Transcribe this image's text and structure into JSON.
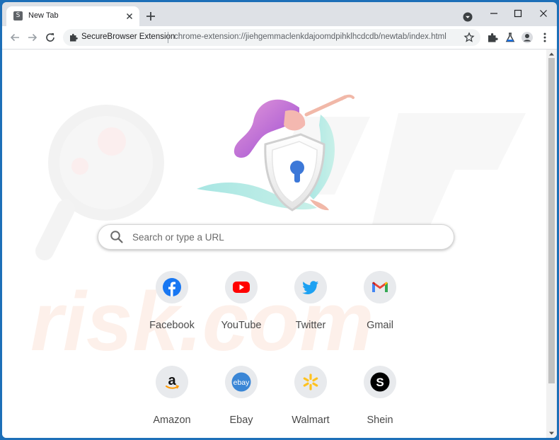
{
  "tab": {
    "title": "New Tab",
    "favicon_letter": "S"
  },
  "omnibox": {
    "origin": "SecureBrowser Extension",
    "url": "chrome-extension://jiehgemmaclenkdajoomdpihklhcdcdb/newtab/index.html"
  },
  "search": {
    "placeholder": "Search or type a URL"
  },
  "watermark_text": "risk.com",
  "shortcuts": [
    {
      "label": "Facebook",
      "icon": "facebook-icon",
      "color": "#1877f2"
    },
    {
      "label": "YouTube",
      "icon": "youtube-icon",
      "color": "#ff0000"
    },
    {
      "label": "Twitter",
      "icon": "twitter-icon",
      "color": "#1da1f2"
    },
    {
      "label": "Gmail",
      "icon": "gmail-icon",
      "color": "#ea4335"
    },
    {
      "label": "Amazon",
      "icon": "amazon-icon",
      "color": "#ff9900"
    },
    {
      "label": "Ebay",
      "icon": "ebay-icon",
      "color": "#3a86d6"
    },
    {
      "label": "Walmart",
      "icon": "walmart-icon",
      "color": "#ffc220"
    },
    {
      "label": "Shein",
      "icon": "shein-icon",
      "color": "#000000"
    }
  ],
  "colors": {
    "frame": "#dee1e6",
    "accent": "#1d6fb8"
  }
}
